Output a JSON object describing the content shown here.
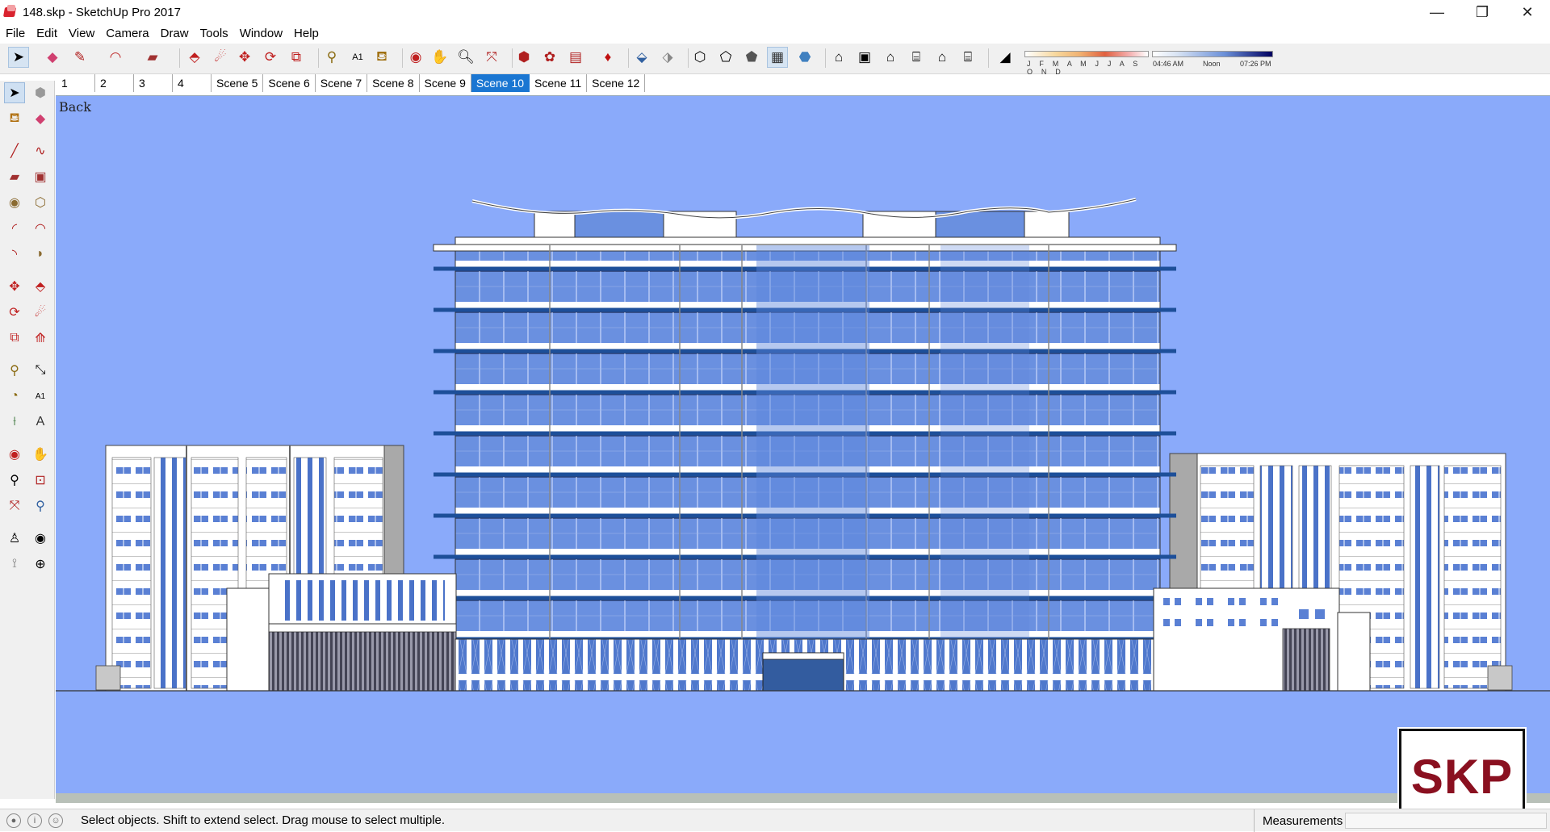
{
  "window": {
    "title": "148.skp - SketchUp Pro 2017",
    "minimize": "—",
    "maximize": "❐",
    "close": "✕"
  },
  "menu": [
    "File",
    "Edit",
    "View",
    "Camera",
    "Draw",
    "Tools",
    "Window",
    "Help"
  ],
  "shadow_settings": {
    "months": "J F M A M J J A S O N D",
    "time_start": "04:46 AM",
    "time_mid": "Noon",
    "time_end": "07:26 PM"
  },
  "scenes": {
    "tabs": [
      "1",
      "2",
      "3",
      "4",
      "Scene 5",
      "Scene 6",
      "Scene 7",
      "Scene 8",
      "Scene 9",
      "Scene 10",
      "Scene 11",
      "Scene 12"
    ],
    "active": "Scene 10"
  },
  "viewport": {
    "view_label": "Back",
    "sky_color": "#8aaafa",
    "watermark": "SKP"
  },
  "status": {
    "message": "Select objects. Shift to extend select. Drag mouse to select multiple.",
    "measurements_label": "Measurements"
  },
  "toolbar_icons": [
    "select-icon",
    "eraser-icon",
    "pencil-icon",
    "arc-icon",
    "rectangle-icon",
    "push-pull-icon",
    "follow-me-icon",
    "move-icon",
    "rotate-icon",
    "scale-icon",
    "tape-measure-icon",
    "text-icon",
    "paint-bucket-icon",
    "orbit-icon",
    "pan-icon",
    "zoom-icon",
    "zoom-extents-icon",
    "warehouse-icon",
    "extension-icon",
    "layout-icon",
    "ruby-icon",
    "xray-icon",
    "back-edges-icon",
    "wireframe-icon",
    "hidden-line-icon",
    "shaded-icon",
    "shaded-textures-icon",
    "monochrome-icon",
    "iso-view-icon",
    "top-view-icon",
    "front-view-icon",
    "right-view-icon",
    "back-view-icon",
    "left-view-icon",
    "shadows-icon"
  ]
}
